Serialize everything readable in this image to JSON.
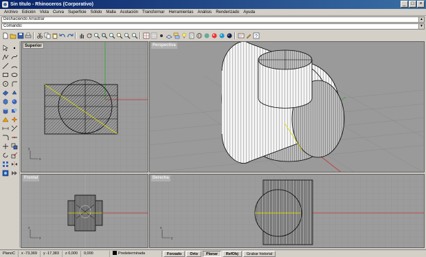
{
  "window": {
    "title": "Sin título - Rhinoceros (Corporativo)",
    "controls": [
      "_",
      "□",
      "×"
    ]
  },
  "menu": {
    "items": [
      "Archivo",
      "Edición",
      "Vista",
      "Curva",
      "Superficie",
      "Sólido",
      "Malla",
      "Acotación",
      "Transformar",
      "Herramientas",
      "Análisis",
      "Renderizado",
      "Ayuda"
    ]
  },
  "command": {
    "history": "Deshaciendo Arrastrar",
    "prompt_label": "Comando:"
  },
  "viewports": {
    "top": {
      "label": "Superior"
    },
    "perspective": {
      "label": "Perspectiva"
    },
    "front": {
      "label": "Frontal"
    },
    "right": {
      "label": "Derecha"
    }
  },
  "status": {
    "cplane": "PlanoC",
    "x": "x -73,369",
    "y": "y -17,383",
    "z": "z 0,000",
    "extra": "0,000",
    "layer": "Predeterminada",
    "snap": "Forzado",
    "ortho": "Orto",
    "planar": "Planar",
    "osnap": "RefObj",
    "history": "Grabar historial"
  }
}
